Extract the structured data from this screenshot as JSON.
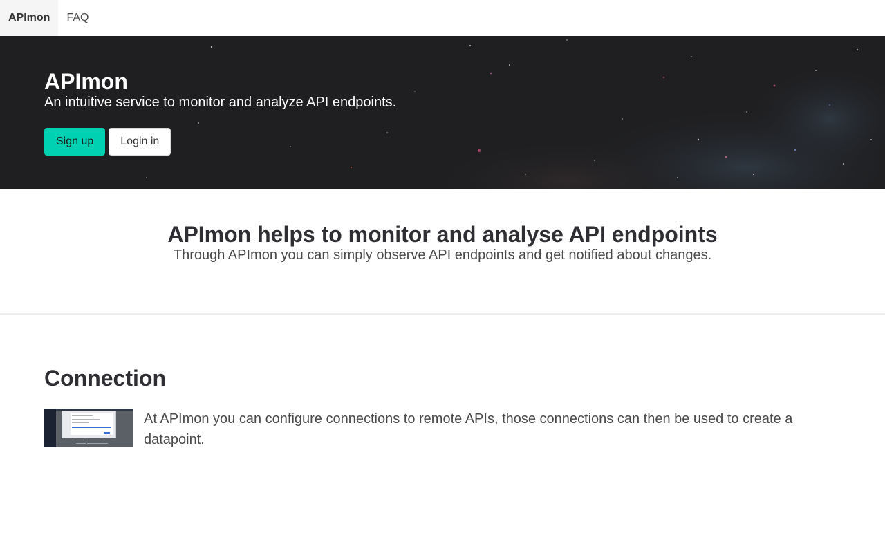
{
  "nav": {
    "brand": "APImon",
    "items": [
      {
        "label": "FAQ"
      }
    ]
  },
  "hero": {
    "title": "APImon",
    "subtitle": "An intuitive service to monitor and analyze API endpoints.",
    "signup_label": "Sign up",
    "login_label": "Login in"
  },
  "intro": {
    "title": "APImon helps to monitor and analyse API endpoints",
    "subtitle": "Through APImon you can simply observe API endpoints and get notified about changes."
  },
  "connection": {
    "title": "Connection",
    "text": "At APImon you can configure connections to remote APIs, those connections can then be used to create a datapoint."
  },
  "colors": {
    "primary": "#00d1b2",
    "hero_bg": "#1f1f21",
    "nav_brand_bg": "#f5f5f5"
  }
}
